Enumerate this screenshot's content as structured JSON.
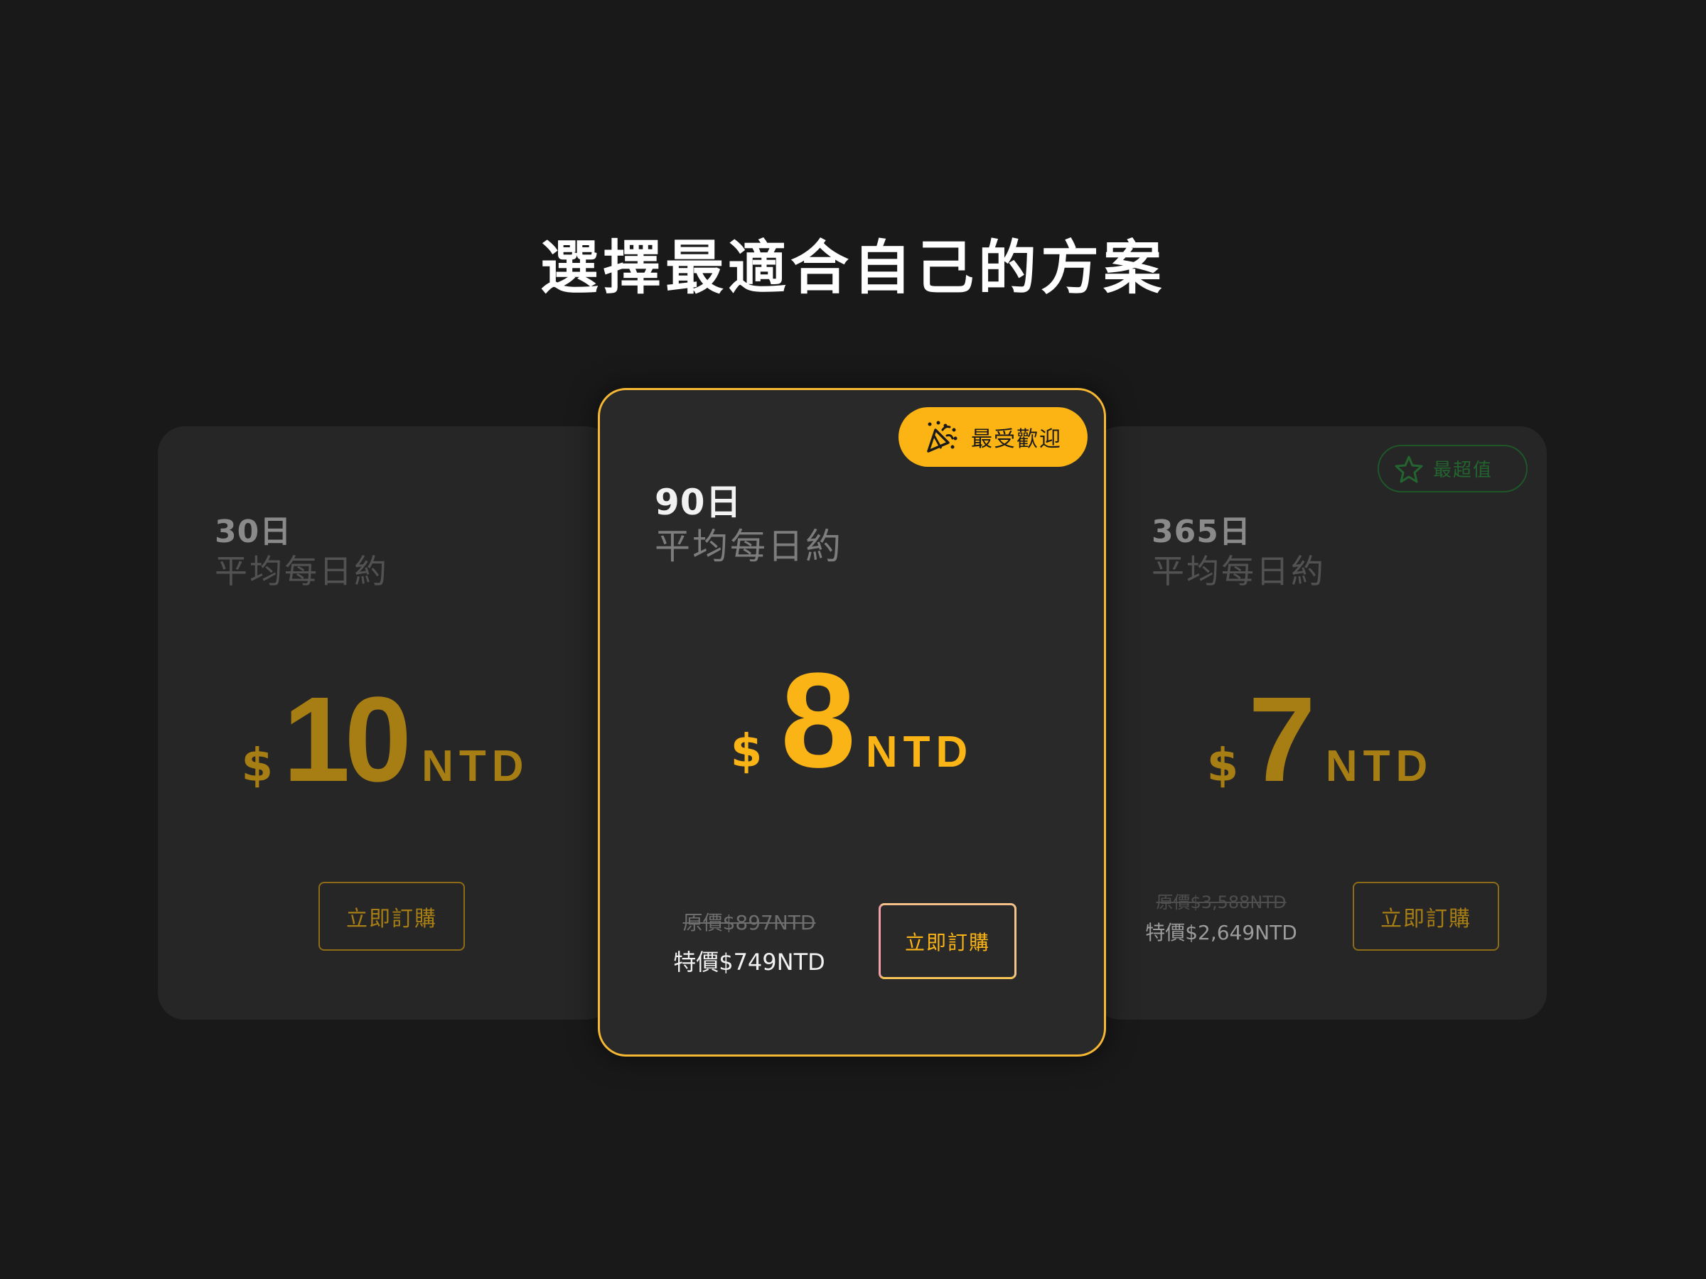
{
  "page": {
    "title": "選擇最適合自己的方案"
  },
  "plans": [
    {
      "days": "30日",
      "subtitle": "平均每日約",
      "currency": "$",
      "price": "10",
      "unit": "NTD",
      "button_label": "立即訂購"
    },
    {
      "days": "90日",
      "subtitle": "平均每日約",
      "currency": "$",
      "price": "8",
      "unit": "NTD",
      "original_price": "原價$897NTD",
      "special_price": "特價$749NTD",
      "button_label": "立即訂購",
      "badge": {
        "label": "最受歡迎",
        "icon": "party-popper-icon",
        "color": "#fcb414"
      }
    },
    {
      "days": "365日",
      "subtitle": "平均每日約",
      "currency": "$",
      "price": "7",
      "unit": "NTD",
      "original_price": "原價$3,588NTD",
      "special_price": "特價$2,649NTD",
      "button_label": "立即訂購",
      "badge": {
        "label": "最超值",
        "icon": "star-icon",
        "color": "#23642f"
      }
    }
  ],
  "colors": {
    "background": "#191919",
    "card": "#262626",
    "accent": "#fbb415",
    "accent_dim": "#a77e14"
  }
}
